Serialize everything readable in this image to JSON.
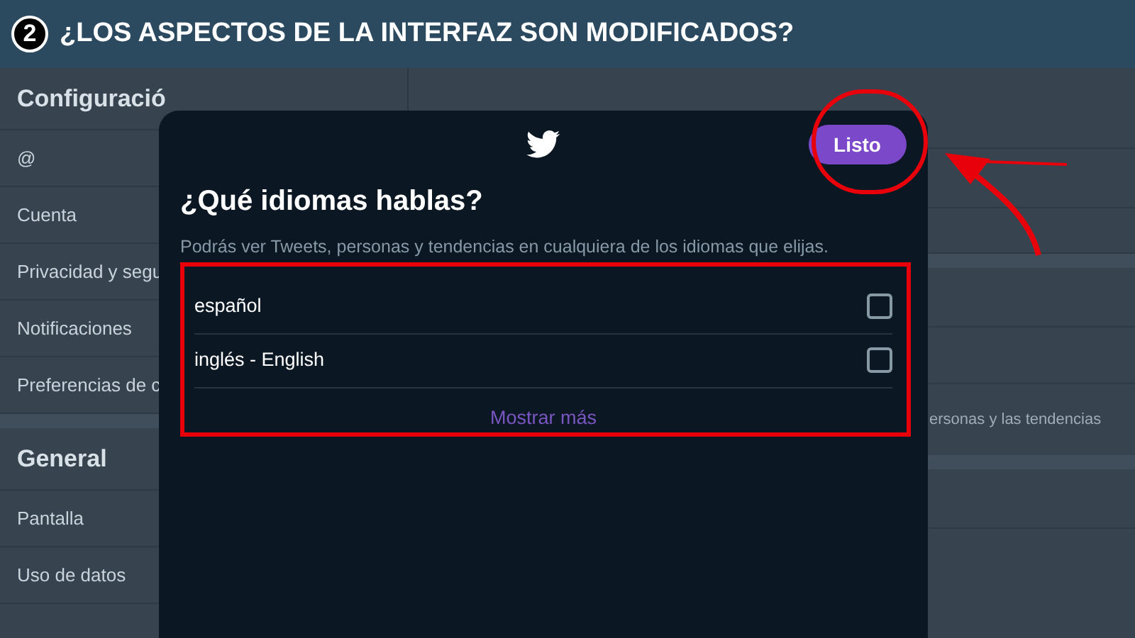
{
  "banner": {
    "step": "2",
    "title": "¿LOS ASPECTOS DE LA INTERFAZ SON MODIFICADOS?"
  },
  "sidebar": {
    "sections": [
      {
        "title": "Configuració",
        "items": [
          "@",
          "Cuenta",
          "Privacidad y segu",
          "Notificaciones",
          "Preferencias de c"
        ]
      },
      {
        "title": "General",
        "items": [
          "Pantalla",
          "Uso de datos"
        ]
      }
    ]
  },
  "content": {
    "hint": "ersonas y las tendencias"
  },
  "dialog": {
    "title": "¿Qué idiomas hablas?",
    "description": "Podrás ver Tweets, personas y tendencias en cualquiera de los idiomas que elijas.",
    "done_button": "Listo",
    "languages": [
      {
        "label": "español",
        "checked": false
      },
      {
        "label": "inglés - English",
        "checked": false
      }
    ],
    "show_more": "Mostrar más"
  }
}
